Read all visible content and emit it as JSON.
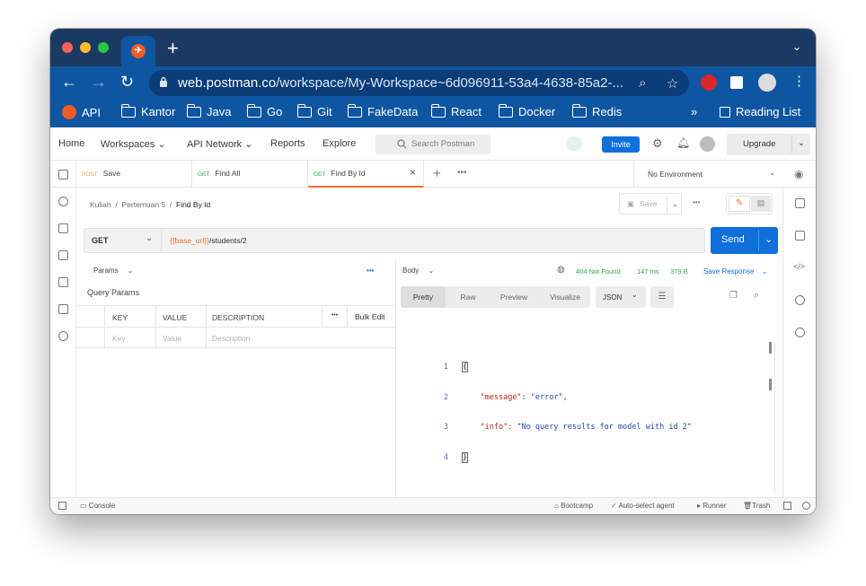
{
  "browser": {
    "url_host": "web.postman.co",
    "url_path": "/workspace/My-Workspace~6d096911-53a4-4638-85a2-...",
    "bookmarks": [
      "API",
      "Kantor",
      "Java",
      "Go",
      "Git",
      "FakeData",
      "React",
      "Docker",
      "Redis"
    ],
    "reading_list": "Reading List",
    "more": "»"
  },
  "header": {
    "nav": [
      "Home",
      "Workspaces",
      "API Network",
      "Reports",
      "Explore"
    ],
    "search_placeholder": "Search Postman",
    "invite": "Invite",
    "upgrade": "Upgrade"
  },
  "tabs": [
    {
      "method": "POST",
      "name": "Save",
      "method_color": "#e8a33d"
    },
    {
      "method": "GET",
      "name": "Find All",
      "method_color": "#2ba84a"
    },
    {
      "method": "GET",
      "name": "Find By Id",
      "method_color": "#2ba84a"
    }
  ],
  "environment": "No Environment",
  "breadcrumb": {
    "parts": [
      "Kuliah",
      "Pertemuan 5"
    ],
    "current": "Find By Id",
    "sep": "/"
  },
  "request": {
    "save": "Save",
    "method": "GET",
    "url_var": "{{base_url}}",
    "url_rest": "/students/2",
    "send": "Send"
  },
  "params": {
    "tab": "Params",
    "section": "Query Params",
    "columns": [
      "KEY",
      "VALUE",
      "DESCRIPTION"
    ],
    "bulk_edit": "Bulk Edit",
    "placeholders": [
      "Key",
      "Value",
      "Description"
    ]
  },
  "response": {
    "tab": "Body",
    "status": "404 Not Found",
    "time": "147 ms",
    "size": "379 B",
    "save_response": "Save Response",
    "views": [
      "Pretty",
      "Raw",
      "Preview",
      "Visualize"
    ],
    "format": "JSON",
    "lines": [
      {
        "n": "1",
        "text": "{"
      },
      {
        "n": "2",
        "key": "\"message\"",
        "value": "\"error\""
      },
      {
        "n": "3",
        "key": "\"info\"",
        "value": "\"No query results for model with id 2\""
      },
      {
        "n": "4",
        "text": "}"
      }
    ]
  },
  "footer": {
    "console": "Console",
    "bootcamp": "Bootcamp",
    "agent": "Auto-select agent",
    "runner": "Runner",
    "trash": "Trash"
  },
  "colors": {
    "accent": "#0f6fdb",
    "brand": "#ff6c37",
    "status_ok": "#2ba84a"
  }
}
